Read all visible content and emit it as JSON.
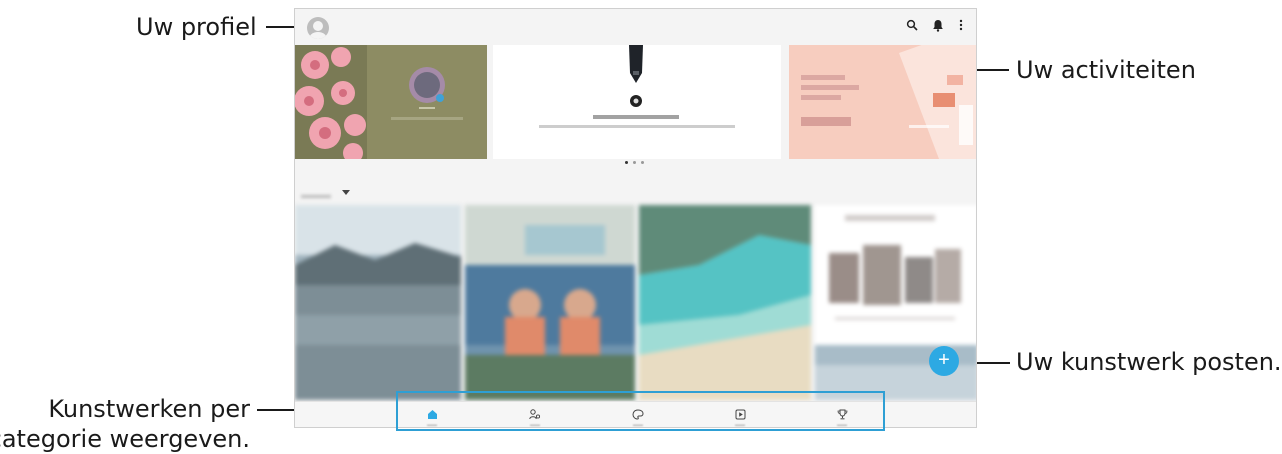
{
  "callouts": {
    "profile": "Uw profiel",
    "activities": "Uw activiteiten",
    "post_artwork": "Uw kunstwerk posten.",
    "categories_line1": "Kunstwerken per",
    "categories_line2": "categorie weergeven."
  },
  "app": {
    "top_icons": [
      "search-icon",
      "bell-icon",
      "more-vert-icon"
    ],
    "banners": [
      "flower-banner",
      "pen-banner",
      "illustration-banner"
    ],
    "carousel": {
      "pages": 3,
      "active": 1
    },
    "feed_tiles": [
      "lake-artwork",
      "statues-artwork",
      "beach-artwork",
      "buildings-artwork",
      "extra-artwork"
    ],
    "fab_symbol": "+",
    "bottom_nav": [
      "home-icon",
      "people-icon",
      "palette-icon",
      "play-icon",
      "trophy-icon"
    ],
    "colors": {
      "accent": "#2da9e3",
      "highlight_box": "#2e9fd4"
    }
  }
}
